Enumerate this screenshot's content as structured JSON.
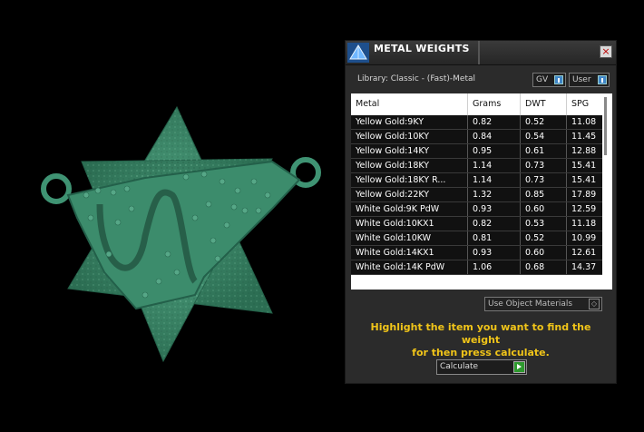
{
  "panel": {
    "title": "METAL WEIGHTS",
    "close_glyph": "×",
    "library_label": "Library: Classic - (Fast)-Metal",
    "toggles": {
      "gv": "GV",
      "user": "User"
    },
    "table": {
      "headers": [
        "Metal",
        "Grams",
        "DWT",
        "SPG"
      ],
      "rows": [
        [
          "Yellow Gold:9KY",
          "0.82",
          "0.52",
          "11.08"
        ],
        [
          "Yellow Gold:10KY",
          "0.84",
          "0.54",
          "11.45"
        ],
        [
          "Yellow Gold:14KY",
          "0.95",
          "0.61",
          "12.88"
        ],
        [
          "Yellow Gold:18KY",
          "1.14",
          "0.73",
          "15.41"
        ],
        [
          "Yellow Gold:18KY R...",
          "1.14",
          "0.73",
          "15.41"
        ],
        [
          "Yellow Gold:22KY",
          "1.32",
          "0.85",
          "17.89"
        ],
        [
          "White Gold:9K PdW",
          "0.93",
          "0.60",
          "12.59"
        ],
        [
          "White Gold:10KX1",
          "0.82",
          "0.53",
          "11.18"
        ],
        [
          "White Gold:10KW",
          "0.81",
          "0.52",
          "10.99"
        ],
        [
          "White Gold:14KX1",
          "0.93",
          "0.60",
          "12.61"
        ],
        [
          "White Gold:14K PdW",
          "1.06",
          "0.68",
          "14.37"
        ]
      ]
    },
    "use_object_materials": "Use Object Materials",
    "hint_line1": "Highlight the item you want to find the weight",
    "hint_line2": "for then press calculate.",
    "calculate_label": "Calculate"
  },
  "icons": {
    "logo": "pyramid-logo-icon",
    "close": "close-icon",
    "toggle_knob": "toggle-switch-icon",
    "dropdown": "dropdown-icon",
    "play": "play-icon"
  },
  "colors": {
    "model_green": "#3b8a6a",
    "hint_yellow": "#f0c419",
    "toggle_blue": "#3f86c7",
    "calculate_green": "#2e9a2e"
  }
}
